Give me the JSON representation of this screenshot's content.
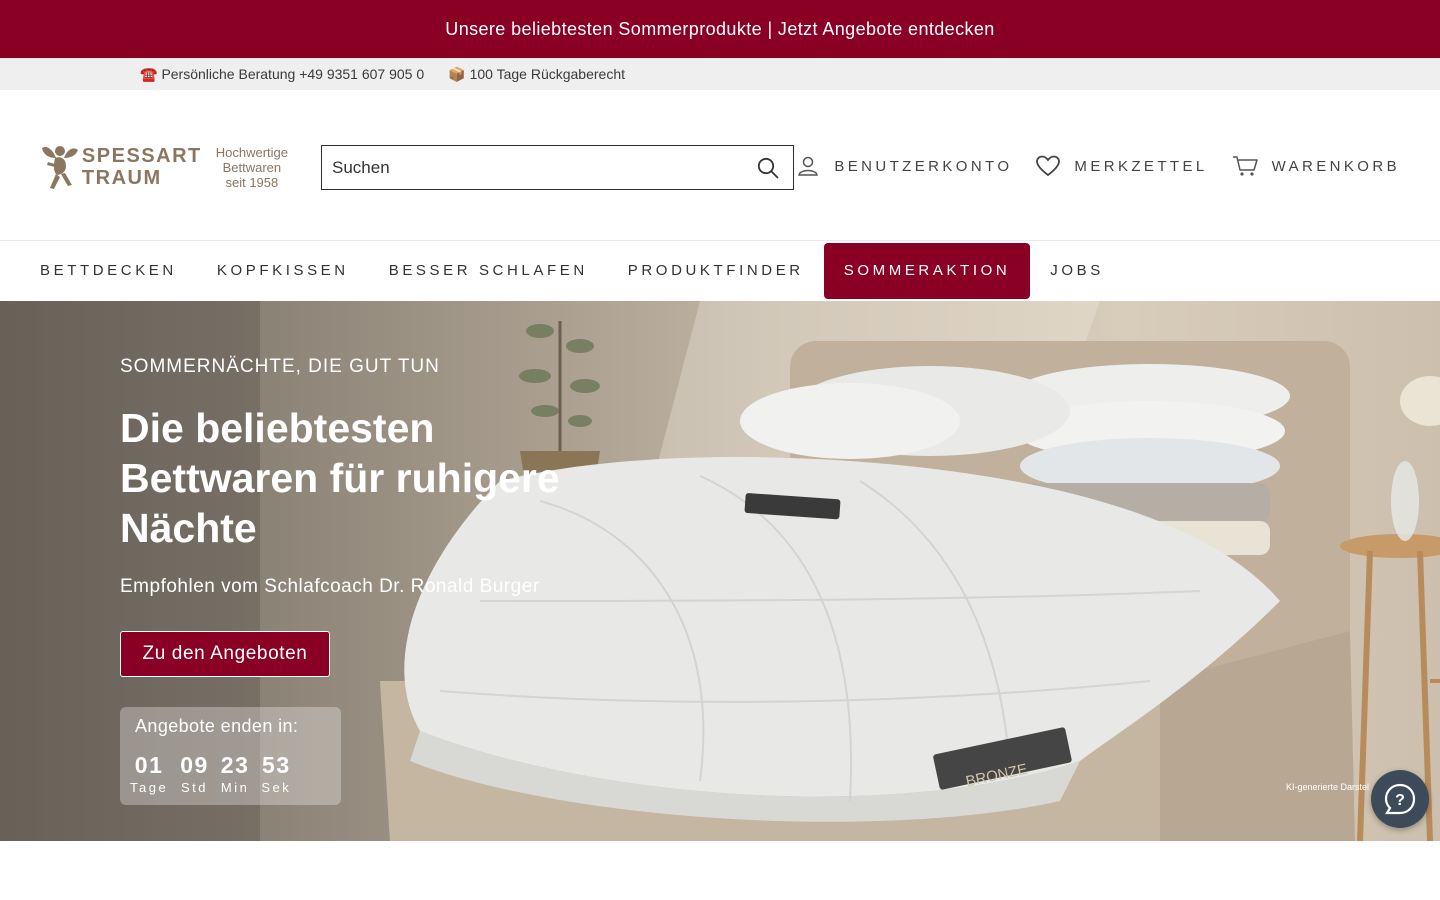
{
  "announcement": {
    "text": "Unsere beliebtesten Sommerprodukte | Jetzt Angebote entdecken"
  },
  "infobar": {
    "phone_icon": "☎️",
    "phone_text": "Persönliche Beratung +49 9351 607 905 0",
    "return_icon": "📦",
    "return_text": "100 Tage Rückgaberecht"
  },
  "header": {
    "logo": {
      "line1": "SPESSART",
      "line2": "TRAUM",
      "tagline1": "Hochwertige",
      "tagline2": "Bettwaren",
      "tagline3": "seit 1958"
    },
    "search": {
      "placeholder": "Suchen"
    },
    "account_label": "BENUTZERKONTO",
    "wishlist_label": "MERKZETTEL",
    "cart_label": "WARENKORB"
  },
  "nav": [
    {
      "label": "BETTDECKEN",
      "active": false
    },
    {
      "label": "KOPFKISSEN",
      "active": false
    },
    {
      "label": "BESSER SCHLAFEN",
      "active": false
    },
    {
      "label": "PRODUKTFINDER",
      "active": false
    },
    {
      "label": "SOMMERAKTION",
      "active": true
    },
    {
      "label": "JOBS",
      "active": false
    }
  ],
  "hero": {
    "kicker": "SOMMERNÄCHTE, DIE GUT TUN",
    "title": "Die beliebtesten Bettwaren für ruhigere Nächte",
    "subtitle": "Empfohlen vom Schlafcoach Dr. Ronald Burger",
    "cta": "Zu den Angeboten",
    "countdown": {
      "label": "Angebote enden in:",
      "units": [
        {
          "value": "01",
          "caption": "Tage"
        },
        {
          "value": "09",
          "caption": "Std"
        },
        {
          "value": "23",
          "caption": "Min"
        },
        {
          "value": "53",
          "caption": "Sek"
        }
      ]
    },
    "label_badge": "BRONZE",
    "disclaimer": "KI-generierte Darstel"
  },
  "colors": {
    "brand": "#8a0024",
    "accent_text": "#8b7760",
    "help_button": "#3d4a59"
  }
}
